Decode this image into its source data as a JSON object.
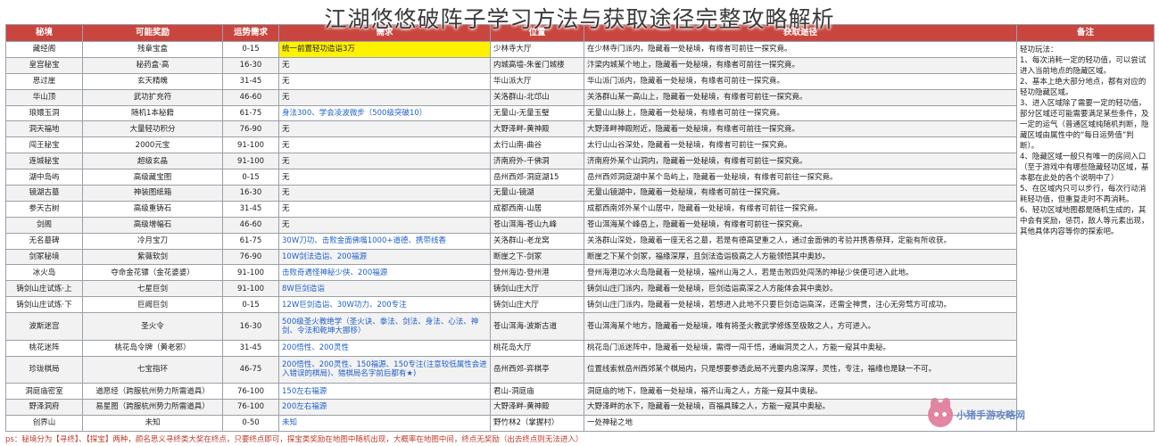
{
  "title": "江湖悠悠破阵子学习方法与获取途径完整攻略解析",
  "headers": {
    "secret": "秘境",
    "reward": "可能奖励",
    "luck": "运势需求",
    "conditions": "需求",
    "location": "位置",
    "method": "获取途径",
    "notes": "备注"
  },
  "rows": [
    {
      "secret": "藏经阁",
      "reward": "残章宝盒",
      "luck": "0-15",
      "conditions": "统一前置轻功造诣3万",
      "location": "少林寺大厅",
      "method": "在少林寺门派内，隐藏着一处秘境，有缘者可前往一探究竟。"
    },
    {
      "secret": "皇宫秘宝",
      "reward": "秘药盒·高",
      "luck": "16-30",
      "conditions": "无",
      "location": "内城高墙-朱雀门城楼",
      "method": "汴梁内城某个地上，隐藏着一处秘境，有缘者可前往一探究竟。"
    },
    {
      "secret": "思过崖",
      "reward": "玄天精魄",
      "luck": "31-45",
      "conditions": "无",
      "location": "华山派大厅",
      "method": "华山派门派内，隐藏着一处秘境，有缘者可前往一探究竟。"
    },
    {
      "secret": "华山顶",
      "reward": "武功扩充符",
      "luck": "46-60",
      "conditions": "无",
      "location": "关洛群山-北邙山",
      "method": "关洛群山某一高山上，隐藏着一处秘境，有缘者可前往一探究竟。"
    },
    {
      "secret": "琅嬛玉洞",
      "reward": "随机1本秘籍",
      "luck": "61-75",
      "conditions": "身法300、学会凌波微步（500级突破10）",
      "location": "无量山-无量玉璧",
      "method": "无量山山脉上，隐藏着一处秘境，有缘者可前往一探究竟。"
    },
    {
      "secret": "洞天福地",
      "reward": "大量轻功积分",
      "luck": "76-90",
      "conditions": "无",
      "location": "大野泽畔-黄神殿",
      "method": "大野泽畔神殿附近，隐藏着一处秘境，有缘者可前往一探究竟。"
    },
    {
      "secret": "闯王秘宝",
      "reward": "2000元宝",
      "luck": "91-100",
      "conditions": "无",
      "location": "太行山南-曲谷",
      "method": "太行山山谷深处，隐藏着一处秘境，有缘者可前往一探究竟。"
    },
    {
      "secret": "连城秘宝",
      "reward": "超级玄晶",
      "luck": "91-100",
      "conditions": "无",
      "location": "济南府外-千佛洞",
      "method": "济南府外某个山洞内，隐藏着一处秘境，有缘者可前往一探究竟。"
    },
    {
      "secret": "湖中岛屿",
      "reward": "高级藏宝图",
      "luck": "0-15",
      "conditions": "无",
      "location": "岳州西郊-洞庭湖15",
      "method": "岳州西郊洞庭湖中某个岛屿上，隐藏着一处秘境，有缘者可前往一探究竟。"
    },
    {
      "secret": "镜湖古墓",
      "reward": "神装图纸箱",
      "luck": "16-30",
      "conditions": "无",
      "location": "无量山-镜湖",
      "method": "无量山镜湖中，隐藏着一处秘境，有缘者可前往一探究竟。"
    },
    {
      "secret": "参天古树",
      "reward": "高级重铸石",
      "luck": "31-45",
      "conditions": "无",
      "location": "成都西南-山居",
      "method": "成都西南郊外某个山居中，隐藏着一处秘境，有缘者可前往一探究竟。"
    },
    {
      "secret": "剑阁",
      "reward": "高级增幅石",
      "luck": "46-60",
      "conditions": "无",
      "location": "苍山洱海-苍山九峰",
      "method": "苍山洱海某个峰岳上，隐藏着一处秘境，有缘者可前往一探究竟。"
    },
    {
      "secret": "无名墓碑",
      "reward": "冷月宝刀",
      "luck": "61-75",
      "conditions": "30W刀功、击败金面佛嘴1000+道德、携带线香",
      "location": "关洛群山-老龙窝",
      "method": "关洛群山深处，隐藏着一座无名之墓，若是有德高望重之人，通过金面佛的考验并携香祭拜，定能有所收获。"
    },
    {
      "secret": "剑冢秘境",
      "reward": "紫薇软剑",
      "luck": "76-90",
      "conditions": "10W剑法造诣、200福源",
      "location": "断崖之下-剑冢",
      "method": "断崖之下某个剑冢，福缘深厚，且剑法造诣极高之人方能领悟其中奥妙。"
    },
    {
      "secret": "冰火岛",
      "reward": "夺命金花镖（金花婆婆）",
      "luck": "91-100",
      "conditions": "击败奇遇怪神秘少侠、200福源",
      "location": "登州海边-登州港",
      "method": "登州海港边冰火岛隐藏着一处秘境，福州山海之人，若是击败四处闯荡的神秘少侠便可进入此地。"
    },
    {
      "secret": "铸剑山庄试炼·上",
      "reward": "七星巨剑",
      "luck": "91-100",
      "conditions": "8W巨剑造诣",
      "location": "铸剑山庄大厅",
      "method": "铸剑山庄门派内，隐藏着一处秘境，巨剑造诣高深之人方能体会其中奥妙。"
    },
    {
      "secret": "铸剑山庄试炼·下",
      "reward": "巨阙巨剑",
      "luck": "0-15",
      "conditions": "12W巨剑造诣、30W功力、200专注",
      "location": "铸剑山庄大厅",
      "method": "铸剑山庄门派内，隐藏着一处秘境，若想进入此地不只要巨剑造诣高深，还需全神贯，注心无旁骛方可成功。"
    },
    {
      "secret": "波斯迷宫",
      "reward": "圣火令",
      "luck": "16-30",
      "conditions": "500级圣火教绝学（圣火诀、拳法、剑法、身法、心法、神剑、令法和乾坤大挪移）",
      "location": "苍山洱海-波斯古道",
      "method": "苍山洱海某个地方，隐藏着一处秘境，唯有将圣火教武学修炼至极致之人，方可进入。"
    },
    {
      "secret": "桃花迷阵",
      "reward": "桃花岛令牌（黄老邪）",
      "luck": "31-45",
      "conditions": "200悟性、200灵性",
      "location": "桃花岛大厅",
      "method": "桃花岛门派迷阵中，隐藏着一处秘境，需得一闯千悟，通幽洞灵之人，方能一窥其中奥秘。"
    },
    {
      "secret": "珍珑棋局",
      "reward": "七宝指环",
      "luck": "46-75",
      "conditions": "200悟性、200灵性、150福源、150专注(注意较低属性会进入错误的棋局)、猎棋局名字前后都有★)",
      "location": "岳州西郊-弈棋亭",
      "method": "位置线索就岳州西郊某个棋局内，只是想要参透此局不光要内息深厚，灵性，专注，福缘也是缺一不可。"
    },
    {
      "secret": "洞庭庙密室",
      "reward": "道愿经（跨服杭州势力所需道具）",
      "luck": "76-100",
      "conditions": "150左右福源",
      "location": "君山-洞庭庙",
      "method": "洞庭庙的地下，隐藏着一处秘境，福齐山海之人，方能一窥其中奥秘。"
    },
    {
      "secret": "野泽洞府",
      "reward": "易星图（跨服杭州势力所需道具）",
      "luck": "76-100",
      "conditions": "200左右福源",
      "location": "大野泽畔-黄神殿",
      "method": "大野泽畔的水下，隐藏着一处秘境，百福具臻之人，方能一窥其中奥秘。"
    },
    {
      "secret": "创界山",
      "reward": "未知",
      "luck": "0-50",
      "conditions": "未知",
      "location": "野竹林2（掌握村）",
      "method": "一处神秘之地"
    }
  ],
  "notes": "轻功玩法：\n1、每次消耗一定的轻功值，可以尝试进入当前地点的隐藏区域。\n2、基本上绝大部分地点，都有对应的轻功隐藏区域。\n3、进入区域除了需要一定的轻功值，部分区域还可能需要满足某些条件，及一定的运气（普通区域纯随机判断，隐藏区域由属性中的“每日运势值”判断）。\n4、隐藏区域一般只有唯一的房间入口（至于游戏中有哪些隐藏轻功区域，基本都在此处的各个说明中了）\n5、在区域内只可以步行，每次行动消耗轻功值，但重复走时不再消耗。\n6、轻功区域地图都是随机生成的，其中会有奖励，惩罚，敌人等元素出现，其他具体内容等你的探索吧。",
  "footnote": "ps：秘境分为【寻终】、【探宝】两种，颜名思义寻终类大奖在终点，只要终点即可，探宝类奖励在地图中随机出现，大概率在地图中间，终点无奖励（出去终点则无法进入）",
  "watermark": "小猪手游攻略网",
  "colors": {
    "header_bg": "#c8463f",
    "highlight": "#fff200",
    "blue_text": "#1f5fc8"
  }
}
